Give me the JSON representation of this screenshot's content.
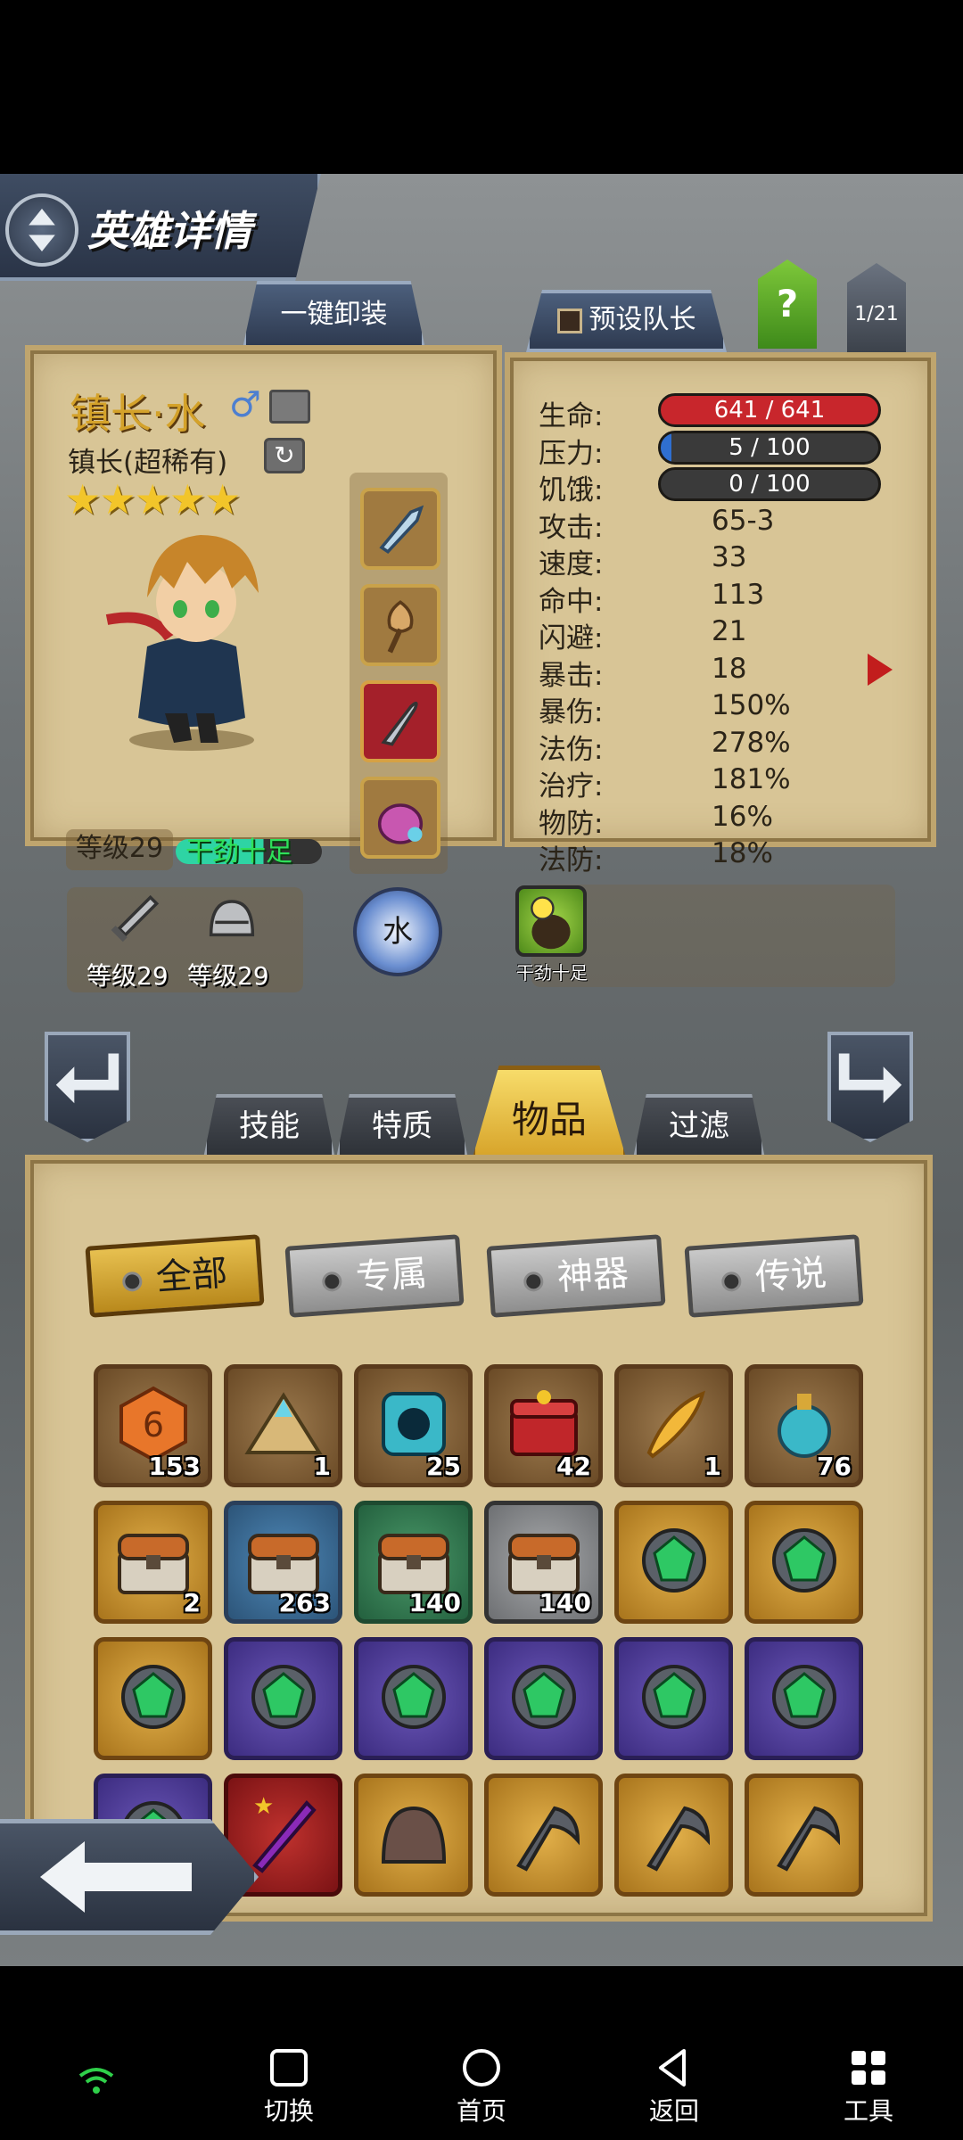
{
  "header": {
    "title": "英雄详情",
    "unload_all": "一键卸装",
    "preset_leader": "预设队长",
    "help": "?",
    "page": "1/21"
  },
  "hero": {
    "name": "镇长·水",
    "class_line": "镇长(超稀有)",
    "stars": 5,
    "level": "等级29",
    "status": "干劲十足",
    "weapon_level": "等级29",
    "armor_level": "等级29",
    "element": "水"
  },
  "stats": [
    {
      "label": "生命:",
      "value": "641 / 641",
      "type": "bar",
      "color": "#c8262c",
      "fill": 1.0
    },
    {
      "label": "压力:",
      "value": "5 / 100",
      "type": "bar",
      "color": "#2f6fd0",
      "fill": 0.05
    },
    {
      "label": "饥饿:",
      "value": "0 / 100",
      "type": "bar",
      "color": "#3a3a3a",
      "fill": 0.0
    },
    {
      "label": "攻击:",
      "value": "65-3"
    },
    {
      "label": "速度:",
      "value": "33"
    },
    {
      "label": "命中:",
      "value": "113"
    },
    {
      "label": "闪避:",
      "value": "21"
    },
    {
      "label": "暴击:",
      "value": "18"
    },
    {
      "label": "暴伤:",
      "value": "150%"
    },
    {
      "label": "法伤:",
      "value": "278%"
    },
    {
      "label": "治疗:",
      "value": "181%"
    },
    {
      "label": "物防:",
      "value": "16%"
    },
    {
      "label": "法防:",
      "value": "18%"
    }
  ],
  "trait": {
    "label": "干劲十足"
  },
  "tabs": [
    "技能",
    "特质",
    "物品",
    "过滤"
  ],
  "filters": [
    "全部",
    "专属",
    "神器",
    "传说"
  ],
  "items": [
    {
      "icon": "rune-stone-icon",
      "color": "brown",
      "count": "153"
    },
    {
      "icon": "crystal-pile-icon",
      "color": "brown",
      "count": "1"
    },
    {
      "icon": "dark-rune-icon",
      "color": "brown",
      "count": "25"
    },
    {
      "icon": "red-chest-icon",
      "color": "brown",
      "count": "42"
    },
    {
      "icon": "golden-feather-icon",
      "color": "brown",
      "count": "1"
    },
    {
      "icon": "potion-icon",
      "color": "brown",
      "count": "76"
    },
    {
      "icon": "chest-icon",
      "color": "gold",
      "count": "2"
    },
    {
      "icon": "chest-icon",
      "color": "blue",
      "count": "263"
    },
    {
      "icon": "chest-icon",
      "color": "green",
      "count": "140"
    },
    {
      "icon": "chest-icon",
      "color": "gray",
      "count": "140"
    },
    {
      "icon": "green-gem-icon",
      "color": "gold",
      "count": ""
    },
    {
      "icon": "green-gem-icon",
      "color": "gold",
      "count": ""
    },
    {
      "icon": "green-gem-icon",
      "color": "gold",
      "count": ""
    },
    {
      "icon": "green-gem-icon",
      "color": "purple",
      "count": ""
    },
    {
      "icon": "green-gem-icon",
      "color": "purple",
      "count": ""
    },
    {
      "icon": "green-gem-icon",
      "color": "purple",
      "count": ""
    },
    {
      "icon": "green-gem-icon",
      "color": "purple",
      "count": ""
    },
    {
      "icon": "green-gem-icon",
      "color": "purple",
      "count": ""
    },
    {
      "icon": "green-gem-icon",
      "color": "purple",
      "count": ""
    },
    {
      "icon": "red-weapon-icon",
      "color": "red",
      "count": ""
    },
    {
      "icon": "helmet-icon",
      "color": "gold",
      "count": ""
    },
    {
      "icon": "scythe-icon",
      "color": "gold",
      "count": ""
    },
    {
      "icon": "scythe-icon",
      "color": "gold",
      "count": ""
    },
    {
      "icon": "scythe-icon",
      "color": "gold",
      "count": ""
    }
  ],
  "nav": {
    "switch": "切换",
    "home": "首页",
    "back": "返回",
    "tools": "工具"
  }
}
